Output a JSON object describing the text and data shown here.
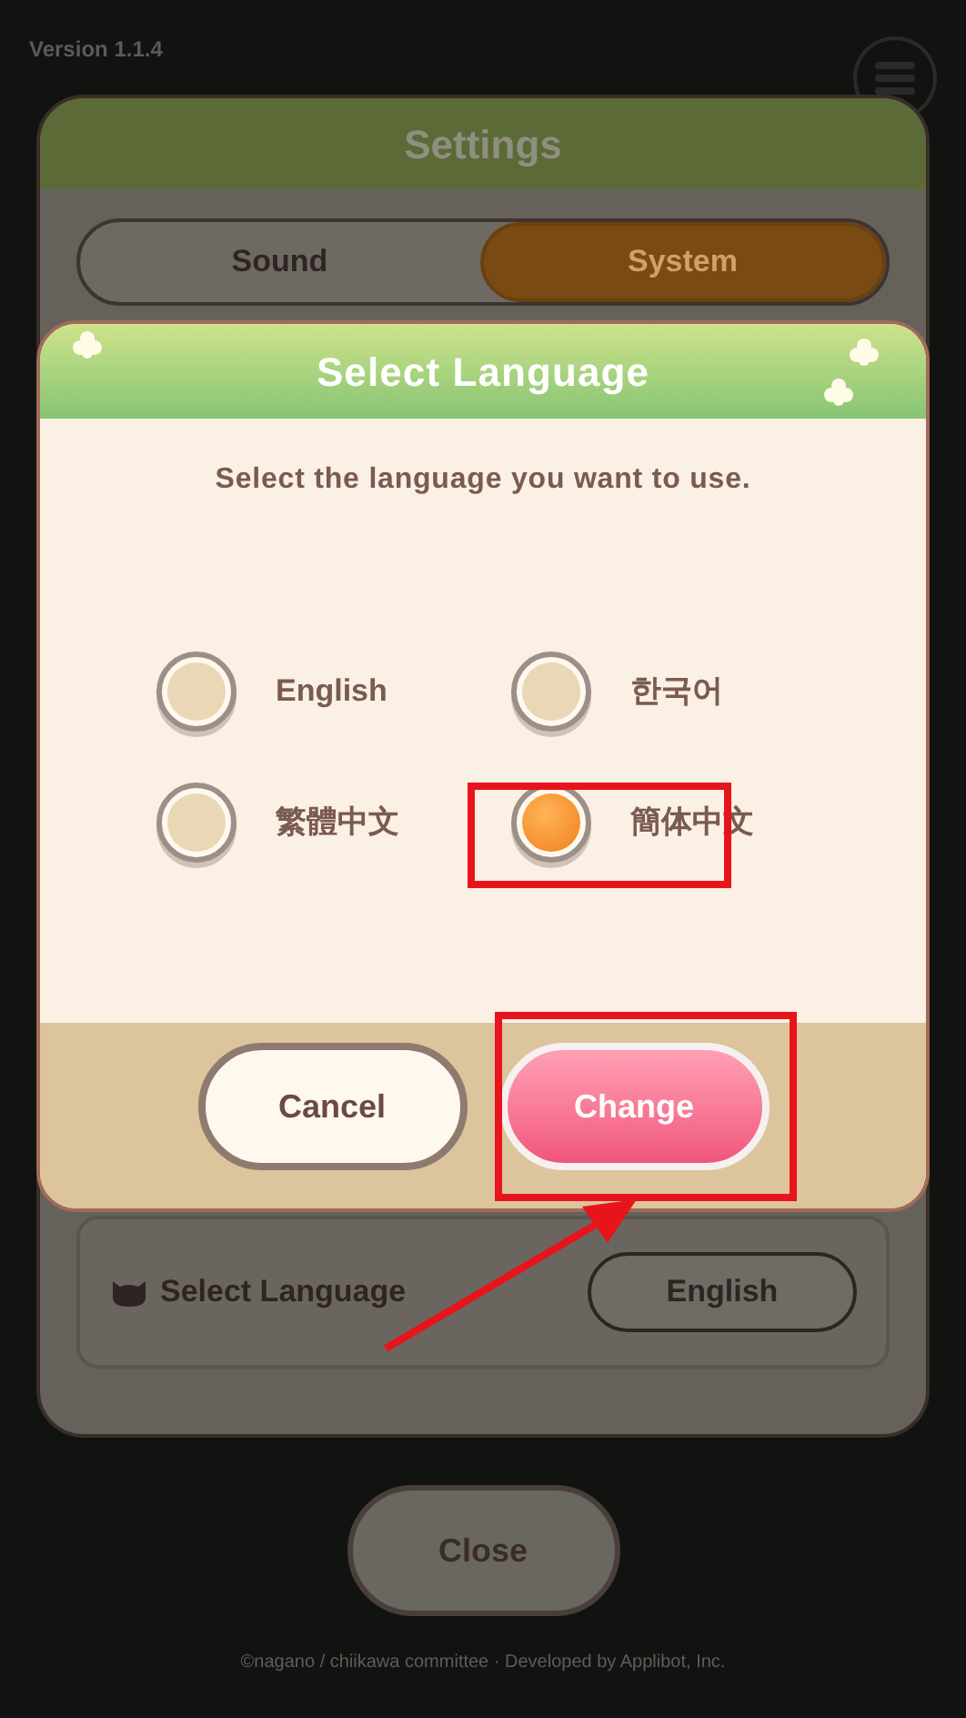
{
  "version": "Version 1.1.4",
  "settings": {
    "title": "Settings",
    "tabs": [
      {
        "label": "Sound",
        "selected": false
      },
      {
        "label": "System",
        "selected": true
      }
    ],
    "language_row": {
      "label": "Select Language",
      "value": "English"
    }
  },
  "dialog": {
    "title": "Select Language",
    "prompt": "Select the language you want to use.",
    "options": [
      {
        "label": "English",
        "selected": false
      },
      {
        "label": "한국어",
        "selected": false
      },
      {
        "label": "繁體中文",
        "selected": false
      },
      {
        "label": "簡体中文",
        "selected": true
      }
    ],
    "buttons": [
      {
        "label": "Cancel",
        "kind": "secondary"
      },
      {
        "label": "Change",
        "kind": "primary"
      }
    ]
  },
  "close_button": "Close",
  "footer": "©nagano / chiikawa committee · Developed by Applibot, Inc."
}
